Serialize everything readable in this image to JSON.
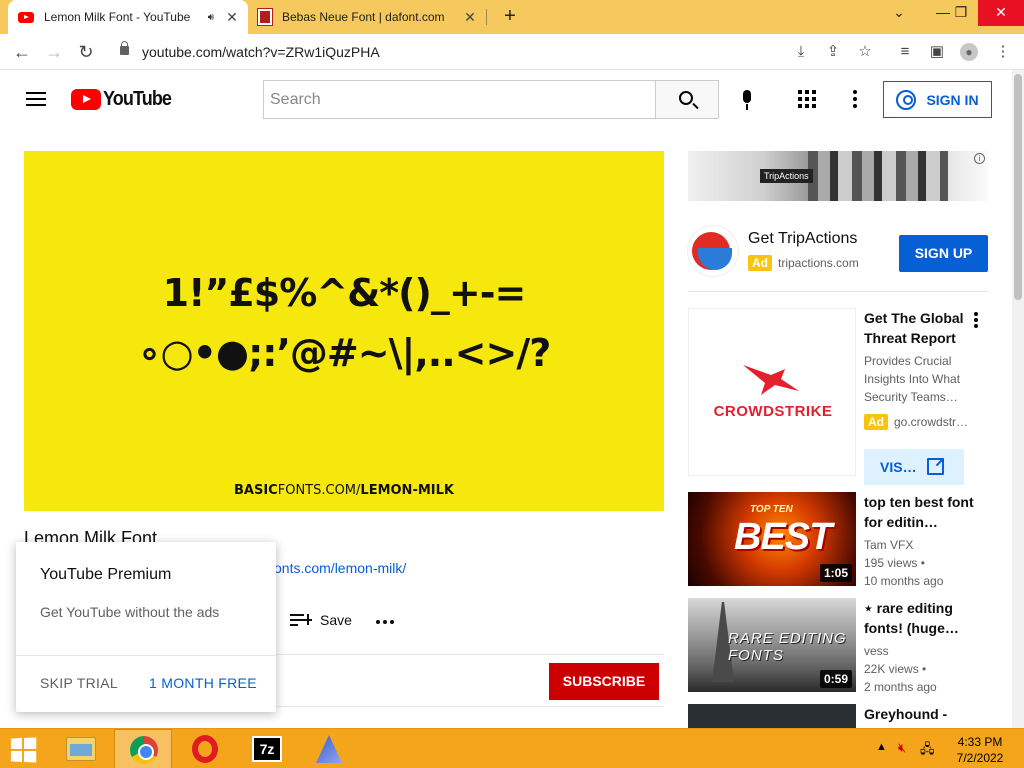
{
  "browser": {
    "tabs": [
      {
        "title": "Lemon Milk Font - YouTube",
        "active": true,
        "icon": "youtube-favicon",
        "audio": true
      },
      {
        "title": "Bebas Neue Font | dafont.com",
        "active": false,
        "icon": "dafont-favicon"
      }
    ],
    "new_tab": "+",
    "window_controls": {
      "collapse": "⌄",
      "minimize": "—",
      "restore": "❐",
      "close": "✕"
    },
    "url": "youtube.com/watch?v=ZRw1iQuzPHA"
  },
  "youtube": {
    "logo_text": "YouTube",
    "search_placeholder": "Search",
    "signin_label": "SIGN IN",
    "video": {
      "glyph_line1": "1!”£$%^&*()_+-=",
      "glyph_line2": "∘○•●;:’@#~\\|,..<>/?",
      "site_bold": "BASIC",
      "site_light": "FONTS.COM/",
      "site_bold2": "LEMON-MILK",
      "title": "Lemon Milk Font",
      "link": "onts.com/lemon-milk/",
      "save_label": "Save",
      "subscribe_label": "SUBSCRIBE"
    },
    "premium_popup": {
      "heading": "YouTube Premium",
      "text": "Get YouTube without the ads",
      "skip_label": "SKIP TRIAL",
      "free_label": "1 MONTH FREE"
    },
    "ad_tripactions": {
      "banner_badge": "TripActions",
      "title": "Get TripActions",
      "ad_tag": "Ad",
      "domain": "tripactions.com",
      "cta": "SIGN UP"
    },
    "ad_crowdstrike": {
      "logo_text": "CROWDSTRIKE",
      "title": "Get The Global Threat Report",
      "description": "Provides Crucial Insights Into What Security Teams…",
      "ad_tag": "Ad",
      "domain": "go.crowdstr…",
      "cta": "VIS…"
    },
    "recommendations": [
      {
        "title": "top ten best font for editin…",
        "channel": "Tam VFX",
        "views": "195 views •",
        "age": "10 months ago",
        "duration": "1:05",
        "thumb_big": "BEST",
        "thumb_small": "TOP TEN"
      },
      {
        "title": "⋆ rare editing fonts! (huge…",
        "channel": "vess",
        "views": "22K views •",
        "age": "2 months ago",
        "duration": "0:59",
        "thumb_text": "RARE EDITING FONTS"
      },
      {
        "title": "Greyhound -"
      }
    ]
  },
  "taskbar": {
    "time": "4:33 PM",
    "date": "7/2/2022",
    "apps": [
      "file-explorer",
      "chrome",
      "opera",
      "7-zip",
      "app"
    ]
  },
  "colors": {
    "tabstrip": "#f6c95e",
    "youtube_red": "#ff0000",
    "subscribe_red": "#cc0000",
    "link_blue": "#065fd4",
    "player_yellow": "#f6e80d",
    "taskbar": "#f4a51c"
  }
}
